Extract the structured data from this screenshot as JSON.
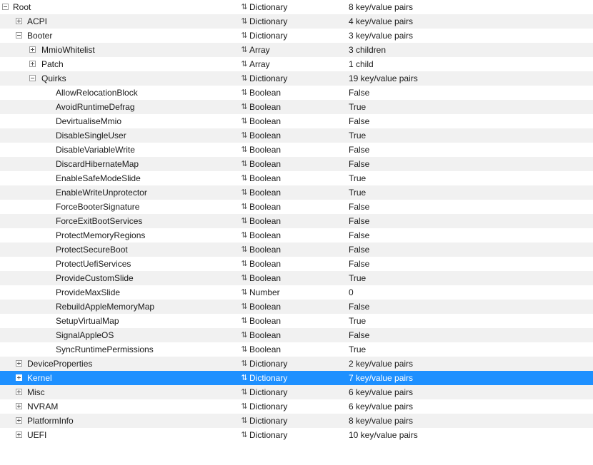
{
  "colors": {
    "selection": "#1e90ff",
    "alternate_row": "#f1f1f1"
  },
  "type_icon": "up-down-arrow-icon",
  "rows": [
    {
      "key": "Root",
      "type": "Dictionary",
      "value": "8 key/value pairs",
      "expander": "minus",
      "level": 0
    },
    {
      "key": "ACPI",
      "type": "Dictionary",
      "value": "4 key/value pairs",
      "expander": "plus",
      "level": 1
    },
    {
      "key": "Booter",
      "type": "Dictionary",
      "value": "3 key/value pairs",
      "expander": "minus",
      "level": 1
    },
    {
      "key": "MmioWhitelist",
      "type": "Array",
      "value": "3 children",
      "expander": "plus",
      "level": 2
    },
    {
      "key": "Patch",
      "type": "Array",
      "value": "1 child",
      "expander": "plus",
      "level": 2
    },
    {
      "key": "Quirks",
      "type": "Dictionary",
      "value": "19 key/value pairs",
      "expander": "minus",
      "level": 2
    },
    {
      "key": "AllowRelocationBlock",
      "type": "Boolean",
      "value": "False",
      "expander": "none",
      "level": 3
    },
    {
      "key": "AvoidRuntimeDefrag",
      "type": "Boolean",
      "value": "True",
      "expander": "none",
      "level": 3
    },
    {
      "key": "DevirtualiseMmio",
      "type": "Boolean",
      "value": "False",
      "expander": "none",
      "level": 3
    },
    {
      "key": "DisableSingleUser",
      "type": "Boolean",
      "value": "True",
      "expander": "none",
      "level": 3
    },
    {
      "key": "DisableVariableWrite",
      "type": "Boolean",
      "value": "False",
      "expander": "none",
      "level": 3
    },
    {
      "key": "DiscardHibernateMap",
      "type": "Boolean",
      "value": "False",
      "expander": "none",
      "level": 3
    },
    {
      "key": "EnableSafeModeSlide",
      "type": "Boolean",
      "value": "True",
      "expander": "none",
      "level": 3
    },
    {
      "key": "EnableWriteUnprotector",
      "type": "Boolean",
      "value": "True",
      "expander": "none",
      "level": 3
    },
    {
      "key": "ForceBooterSignature",
      "type": "Boolean",
      "value": "False",
      "expander": "none",
      "level": 3
    },
    {
      "key": "ForceExitBootServices",
      "type": "Boolean",
      "value": "False",
      "expander": "none",
      "level": 3
    },
    {
      "key": "ProtectMemoryRegions",
      "type": "Boolean",
      "value": "False",
      "expander": "none",
      "level": 3
    },
    {
      "key": "ProtectSecureBoot",
      "type": "Boolean",
      "value": "False",
      "expander": "none",
      "level": 3
    },
    {
      "key": "ProtectUefiServices",
      "type": "Boolean",
      "value": "False",
      "expander": "none",
      "level": 3
    },
    {
      "key": "ProvideCustomSlide",
      "type": "Boolean",
      "value": "True",
      "expander": "none",
      "level": 3
    },
    {
      "key": "ProvideMaxSlide",
      "type": "Number",
      "value": "0",
      "expander": "none",
      "level": 3
    },
    {
      "key": "RebuildAppleMemoryMap",
      "type": "Boolean",
      "value": "False",
      "expander": "none",
      "level": 3
    },
    {
      "key": "SetupVirtualMap",
      "type": "Boolean",
      "value": "True",
      "expander": "none",
      "level": 3
    },
    {
      "key": "SignalAppleOS",
      "type": "Boolean",
      "value": "False",
      "expander": "none",
      "level": 3
    },
    {
      "key": "SyncRuntimePermissions",
      "type": "Boolean",
      "value": "True",
      "expander": "none",
      "level": 3
    },
    {
      "key": "DeviceProperties",
      "type": "Dictionary",
      "value": "2 key/value pairs",
      "expander": "plus",
      "level": 1
    },
    {
      "key": "Kernel",
      "type": "Dictionary",
      "value": "7 key/value pairs",
      "expander": "plus",
      "level": 1,
      "selected": true
    },
    {
      "key": "Misc",
      "type": "Dictionary",
      "value": "6 key/value pairs",
      "expander": "plus",
      "level": 1
    },
    {
      "key": "NVRAM",
      "type": "Dictionary",
      "value": "6 key/value pairs",
      "expander": "plus",
      "level": 1
    },
    {
      "key": "PlatformInfo",
      "type": "Dictionary",
      "value": "8 key/value pairs",
      "expander": "plus",
      "level": 1
    },
    {
      "key": "UEFI",
      "type": "Dictionary",
      "value": "10 key/value pairs",
      "expander": "plus",
      "level": 1
    }
  ]
}
